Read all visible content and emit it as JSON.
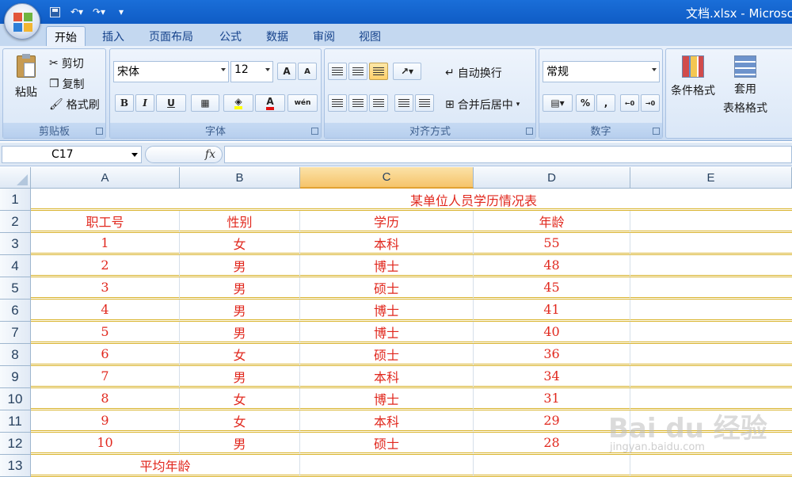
{
  "window": {
    "title": "文档.xlsx - Microsc"
  },
  "ribbon": {
    "tabs": [
      {
        "label": "开始",
        "active": true
      },
      {
        "label": "插入"
      },
      {
        "label": "页面布局"
      },
      {
        "label": "公式"
      },
      {
        "label": "数据"
      },
      {
        "label": "审阅"
      },
      {
        "label": "视图"
      }
    ],
    "clipboard": {
      "paste": "粘贴",
      "cut": "剪切",
      "copy": "复制",
      "format_painter": "格式刷",
      "group_label": "剪贴板"
    },
    "font": {
      "name": "宋体",
      "size": "12",
      "bold": "B",
      "italic": "I",
      "underline": "U",
      "grow": "A",
      "shrink": "A",
      "font_color": "A",
      "phonetic": "wén",
      "group_label": "字体"
    },
    "alignment": {
      "wrap_text": "自动换行",
      "merge_center": "合并后居中",
      "group_label": "对齐方式"
    },
    "number": {
      "format": "常规",
      "percent": "%",
      "comma": ",",
      "group_label": "数字"
    },
    "styles": {
      "conditional_format": "条件格式",
      "table_format_1": "套用",
      "table_format_2": "表格格式"
    }
  },
  "formula_bar": {
    "name_box": "C17",
    "fx": "fx",
    "value": ""
  },
  "sheet": {
    "columns": [
      "A",
      "B",
      "C",
      "D",
      "E"
    ],
    "selected_column": "C",
    "rows": [
      "1",
      "2",
      "3",
      "4",
      "5",
      "6",
      "7",
      "8",
      "9",
      "10",
      "11",
      "12",
      "13"
    ],
    "title": "某单位人员学历情况表",
    "headers": [
      "职工号",
      "性别",
      "学历",
      "年龄"
    ],
    "records": [
      [
        "1",
        "女",
        "本科",
        "55"
      ],
      [
        "2",
        "男",
        "博士",
        "48"
      ],
      [
        "3",
        "男",
        "硕士",
        "45"
      ],
      [
        "4",
        "男",
        "博士",
        "41"
      ],
      [
        "5",
        "男",
        "博士",
        "40"
      ],
      [
        "6",
        "女",
        "硕士",
        "36"
      ],
      [
        "7",
        "男",
        "本科",
        "34"
      ],
      [
        "8",
        "女",
        "博士",
        "31"
      ],
      [
        "9",
        "女",
        "本科",
        "29"
      ],
      [
        "10",
        "男",
        "硕士",
        "28"
      ]
    ],
    "footer": "平均年龄"
  },
  "watermark": {
    "text": "Bai du 经验",
    "sub": "jingyan.baidu.com"
  },
  "colors": {
    "cell_text": "#e1281e",
    "border_accent": "#d9b32c",
    "title_bar": "#1a6ed8"
  }
}
